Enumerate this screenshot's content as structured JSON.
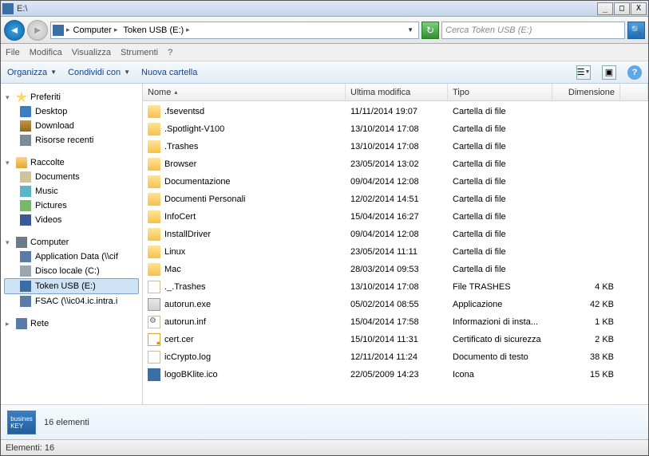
{
  "title": "E:\\",
  "win_buttons": {
    "min": "_",
    "max": "□",
    "close": "X"
  },
  "breadcrumbs": [
    "Computer",
    "Token USB (E:)"
  ],
  "search_placeholder": "Cerca Token USB (E:)",
  "menu": {
    "file": "File",
    "modifica": "Modifica",
    "visualizza": "Visualizza",
    "strumenti": "Strumenti",
    "help": "?"
  },
  "toolbar": {
    "organizza": "Organizza",
    "condividi": "Condividi con",
    "nuova": "Nuova cartella"
  },
  "columns": {
    "name": "Nome",
    "date": "Ultima modifica",
    "type": "Tipo",
    "size": "Dimensione"
  },
  "sidebar": {
    "preferiti": {
      "label": "Preferiti",
      "items": [
        {
          "icon": "i-desk",
          "label": "Desktop"
        },
        {
          "icon": "i-dl",
          "label": "Download"
        },
        {
          "icon": "i-recent",
          "label": "Risorse recenti"
        }
      ]
    },
    "raccolte": {
      "label": "Raccolte",
      "items": [
        {
          "icon": "i-doc",
          "label": "Documents"
        },
        {
          "icon": "i-music",
          "label": "Music"
        },
        {
          "icon": "i-pic",
          "label": "Pictures"
        },
        {
          "icon": "i-vid",
          "label": "Videos"
        }
      ]
    },
    "computer": {
      "label": "Computer",
      "items": [
        {
          "icon": "i-net",
          "label": "Application Data (\\\\cif"
        },
        {
          "icon": "i-drv",
          "label": "Disco locale (C:)"
        },
        {
          "icon": "i-key",
          "label": "Token USB (E:)",
          "selected": true
        },
        {
          "icon": "i-net",
          "label": "FSAC (\\\\ic04.ic.intra.i"
        }
      ]
    },
    "rete": {
      "label": "Rete"
    }
  },
  "files": [
    {
      "icon": "fi-folder",
      "name": ".fseventsd",
      "date": "11/11/2014 19:07",
      "type": "Cartella di file",
      "size": ""
    },
    {
      "icon": "fi-folder",
      "name": ".Spotlight-V100",
      "date": "13/10/2014 17:08",
      "type": "Cartella di file",
      "size": ""
    },
    {
      "icon": "fi-folder",
      "name": ".Trashes",
      "date": "13/10/2014 17:08",
      "type": "Cartella di file",
      "size": ""
    },
    {
      "icon": "fi-folder",
      "name": "Browser",
      "date": "23/05/2014 13:02",
      "type": "Cartella di file",
      "size": ""
    },
    {
      "icon": "fi-folder",
      "name": "Documentazione",
      "date": "09/04/2014 12:08",
      "type": "Cartella di file",
      "size": ""
    },
    {
      "icon": "fi-folder",
      "name": "Documenti Personali",
      "date": "12/02/2014 14:51",
      "type": "Cartella di file",
      "size": ""
    },
    {
      "icon": "fi-folder",
      "name": "InfoCert",
      "date": "15/04/2014 16:27",
      "type": "Cartella di file",
      "size": ""
    },
    {
      "icon": "fi-folder",
      "name": "InstallDriver",
      "date": "09/04/2014 12:08",
      "type": "Cartella di file",
      "size": ""
    },
    {
      "icon": "fi-folder",
      "name": "Linux",
      "date": "23/05/2014 11:11",
      "type": "Cartella di file",
      "size": ""
    },
    {
      "icon": "fi-folder",
      "name": "Mac",
      "date": "28/03/2014 09:53",
      "type": "Cartella di file",
      "size": ""
    },
    {
      "icon": "fi-file",
      "name": "._.Trashes",
      "date": "13/10/2014 17:08",
      "type": "File TRASHES",
      "size": "4 KB"
    },
    {
      "icon": "fi-exe",
      "name": "autorun.exe",
      "date": "05/02/2014 08:55",
      "type": "Applicazione",
      "size": "42 KB"
    },
    {
      "icon": "fi-inf",
      "name": "autorun.inf",
      "date": "15/04/2014 17:58",
      "type": "Informazioni di insta...",
      "size": "1 KB"
    },
    {
      "icon": "fi-cert",
      "name": "cert.cer",
      "date": "15/10/2014 11:31",
      "type": "Certificato di sicurezza",
      "size": "2 KB"
    },
    {
      "icon": "fi-txt",
      "name": "icCrypto.log",
      "date": "12/11/2014 11:24",
      "type": "Documento di testo",
      "size": "38 KB"
    },
    {
      "icon": "fi-ico",
      "name": "logoBKlite.ico",
      "date": "22/05/2009 14:23",
      "type": "Icona",
      "size": "15 KB"
    }
  ],
  "details": {
    "count": "16 elementi"
  },
  "status": "Elementi: 16"
}
